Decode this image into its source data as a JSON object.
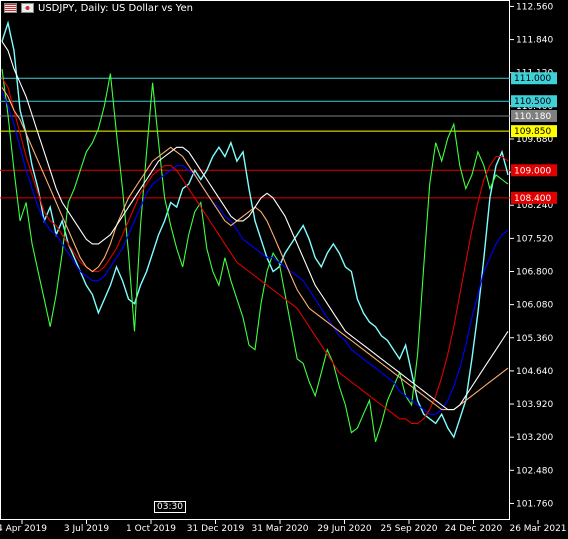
{
  "header": {
    "symbol": "USDJPY",
    "title": "USDJPY, Daily:  US Dollar vs Yen",
    "flag_left": "us-flag-icon",
    "flag_right": "jp-flag-icon"
  },
  "cursor_time": "03:30",
  "chart_data": {
    "type": "line",
    "title": "USDJPY, Daily:  US Dollar vs Yen",
    "ylim": [
      101.4,
      112.7
    ],
    "y_ticks": [
      "112.560",
      "111.840",
      "111.120",
      "110.400",
      "109.680",
      "108.960",
      "108.240",
      "107.520",
      "106.800",
      "106.080",
      "105.360",
      "104.640",
      "103.920",
      "103.200",
      "102.480",
      "101.760"
    ],
    "x_ticks": [
      "4 Apr 2019",
      "3 Jul 2019",
      "1 Oct 2019",
      "31 Dec 2019",
      "31 Mar 2020",
      "29 Jun 2020",
      "25 Sep 2020",
      "24 Dec 2020",
      "26 Mar 2021"
    ],
    "horizontal_levels": [
      {
        "value": 111.0,
        "label": "111.000",
        "color": "#40d0d8"
      },
      {
        "value": 110.5,
        "label": "110.500",
        "color": "#40d0d8"
      },
      {
        "value": 110.18,
        "label": "110.180",
        "color": "#808080"
      },
      {
        "value": 109.85,
        "label": "109.850",
        "color": "#ffff00"
      },
      {
        "value": 109.0,
        "label": "109.000",
        "color": "#e00000"
      },
      {
        "value": 108.4,
        "label": "108.400",
        "color": "#e00000"
      }
    ],
    "series": [
      {
        "color": "#7fffff",
        "values": [
          111.8,
          112.2,
          111.6,
          110.3,
          109.8,
          109.1,
          108.6,
          107.9,
          108.2,
          107.6,
          107.9,
          107.4,
          107.1,
          106.8,
          106.5,
          106.3,
          105.9,
          106.2,
          106.5,
          106.9,
          106.6,
          106.2,
          106.1,
          106.5,
          106.8,
          107.2,
          107.6,
          107.9,
          108.3,
          108.2,
          108.6,
          108.7,
          109.0,
          108.8,
          109.0,
          109.3,
          109.5,
          109.3,
          109.6,
          109.2,
          109.4,
          108.6,
          107.9,
          107.5,
          107.1,
          106.8,
          106.9,
          107.2,
          107.4,
          107.6,
          107.8,
          107.5,
          107.1,
          106.9,
          107.2,
          107.4,
          107.2,
          106.9,
          106.8,
          106.2,
          105.9,
          105.7,
          105.6,
          105.4,
          105.3,
          105.1,
          104.9,
          105.2,
          104.6,
          104.0,
          103.7,
          103.6,
          103.5,
          103.7,
          103.4,
          103.2,
          103.6,
          104.0,
          104.9,
          105.9,
          107.1,
          108.4,
          109.1,
          109.4,
          108.9
        ]
      },
      {
        "color": "#40ff40",
        "values": [
          111.2,
          110.2,
          109.0,
          107.9,
          108.3,
          107.4,
          106.8,
          106.2,
          105.6,
          106.3,
          107.2,
          108.3,
          108.6,
          109.0,
          109.4,
          109.6,
          109.9,
          110.4,
          111.1,
          109.8,
          108.6,
          107.2,
          105.5,
          107.8,
          109.4,
          110.9,
          109.6,
          108.4,
          107.8,
          107.3,
          106.9,
          107.6,
          108.1,
          108.3,
          107.3,
          106.8,
          106.5,
          107.1,
          106.6,
          106.2,
          105.8,
          105.2,
          105.1,
          106.1,
          106.8,
          107.2,
          107.0,
          106.3,
          105.6,
          104.9,
          104.8,
          104.4,
          104.1,
          104.6,
          105.1,
          104.8,
          104.3,
          103.9,
          103.3,
          103.4,
          103.7,
          104.0,
          103.1,
          103.5,
          104.0,
          104.3,
          104.6,
          104.1,
          103.9,
          105.0,
          106.9,
          108.7,
          109.6,
          109.2,
          109.7,
          110.0,
          109.1,
          108.6,
          108.9,
          109.4,
          109.1,
          108.6,
          108.9,
          108.8,
          108.7
        ]
      },
      {
        "color": "#0000ff",
        "values": [
          110.7,
          110.4,
          110.0,
          109.5,
          109.0,
          108.6,
          108.2,
          107.9,
          107.7,
          107.6,
          107.4,
          107.2,
          107.0,
          106.8,
          106.7,
          106.6,
          106.6,
          106.7,
          106.9,
          107.1,
          107.3,
          107.6,
          107.9,
          108.2,
          108.5,
          108.7,
          108.8,
          108.9,
          109.0,
          109.1,
          109.1,
          109.0,
          108.9,
          108.7,
          108.5,
          108.3,
          108.2,
          108.0,
          107.9,
          107.7,
          107.5,
          107.4,
          107.3,
          107.2,
          107.1,
          107.1,
          107.0,
          106.9,
          106.8,
          106.7,
          106.6,
          106.4,
          106.2,
          106.0,
          105.8,
          105.6,
          105.4,
          105.3,
          105.1,
          105.0,
          104.9,
          104.8,
          104.7,
          104.6,
          104.5,
          104.4,
          104.2,
          104.1,
          104.0,
          103.9,
          103.8,
          103.7,
          103.7,
          103.8,
          104.0,
          104.3,
          104.7,
          105.2,
          105.8,
          106.3,
          106.8,
          107.1,
          107.4,
          107.6,
          107.7
        ]
      },
      {
        "color": "#e00000",
        "values": [
          111.0,
          110.8,
          110.3,
          109.8,
          109.3,
          108.9,
          108.5,
          108.1,
          107.9,
          107.8,
          107.6,
          107.4,
          107.2,
          107.0,
          106.9,
          106.8,
          106.8,
          106.9,
          107.1,
          107.3,
          107.6,
          107.9,
          108.2,
          108.5,
          108.7,
          108.9,
          109.0,
          109.1,
          109.1,
          109.0,
          108.8,
          108.6,
          108.4,
          108.2,
          108.0,
          107.8,
          107.6,
          107.4,
          107.2,
          107.0,
          106.9,
          106.8,
          106.7,
          106.6,
          106.5,
          106.4,
          106.3,
          106.2,
          106.1,
          106.0,
          105.8,
          105.6,
          105.4,
          105.2,
          105.0,
          104.8,
          104.6,
          104.5,
          104.4,
          104.3,
          104.2,
          104.1,
          104.0,
          103.9,
          103.8,
          103.7,
          103.6,
          103.6,
          103.5,
          103.5,
          103.6,
          103.8,
          104.1,
          104.5,
          105.0,
          105.6,
          106.3,
          107.0,
          107.7,
          108.3,
          108.8,
          109.1,
          109.3,
          109.3,
          109.2
        ]
      },
      {
        "color": "#ffb070",
        "values": [
          110.8,
          110.6,
          110.3,
          110.1,
          109.8,
          109.5,
          109.2,
          108.9,
          108.6,
          108.3,
          108.0,
          107.7,
          107.4,
          107.1,
          106.9,
          106.8,
          106.9,
          107.1,
          107.4,
          107.8,
          108.1,
          108.4,
          108.6,
          108.8,
          109.0,
          109.2,
          109.3,
          109.4,
          109.5,
          109.4,
          109.3,
          109.1,
          108.9,
          108.7,
          108.5,
          108.3,
          108.1,
          107.9,
          107.8,
          107.9,
          108.0,
          108.1,
          108.2,
          108.1,
          107.9,
          107.6,
          107.3,
          107.0,
          106.7,
          106.4,
          106.2,
          106.0,
          105.9,
          105.8,
          105.7,
          105.6,
          105.5,
          105.4,
          105.3,
          105.2,
          105.1,
          105.0,
          104.9,
          104.8,
          104.7,
          104.6,
          104.5,
          104.4,
          104.3,
          104.2,
          104.1,
          104.0,
          103.9,
          103.8,
          103.8,
          103.8,
          103.9,
          104.0,
          104.1,
          104.2,
          104.3,
          104.4,
          104.5,
          104.6,
          104.7
        ]
      },
      {
        "color": "#ffffff",
        "values": [
          111.8,
          111.6,
          111.2,
          110.9,
          110.6,
          110.2,
          109.8,
          109.4,
          109.0,
          108.6,
          108.3,
          108.1,
          107.9,
          107.7,
          107.5,
          107.4,
          107.4,
          107.5,
          107.6,
          107.8,
          108.0,
          108.2,
          108.4,
          108.6,
          108.8,
          109.0,
          109.2,
          109.3,
          109.4,
          109.5,
          109.5,
          109.4,
          109.2,
          109.0,
          108.8,
          108.6,
          108.4,
          108.2,
          108.0,
          107.9,
          107.9,
          108.0,
          108.2,
          108.4,
          108.5,
          108.4,
          108.2,
          108.0,
          107.7,
          107.4,
          107.1,
          106.8,
          106.5,
          106.3,
          106.1,
          105.9,
          105.7,
          105.5,
          105.4,
          105.3,
          105.2,
          105.1,
          105.0,
          104.9,
          104.8,
          104.7,
          104.6,
          104.5,
          104.4,
          104.3,
          104.2,
          104.1,
          104.0,
          103.9,
          103.8,
          103.8,
          103.9,
          104.1,
          104.3,
          104.5,
          104.7,
          104.9,
          105.1,
          105.3,
          105.5
        ]
      }
    ]
  }
}
